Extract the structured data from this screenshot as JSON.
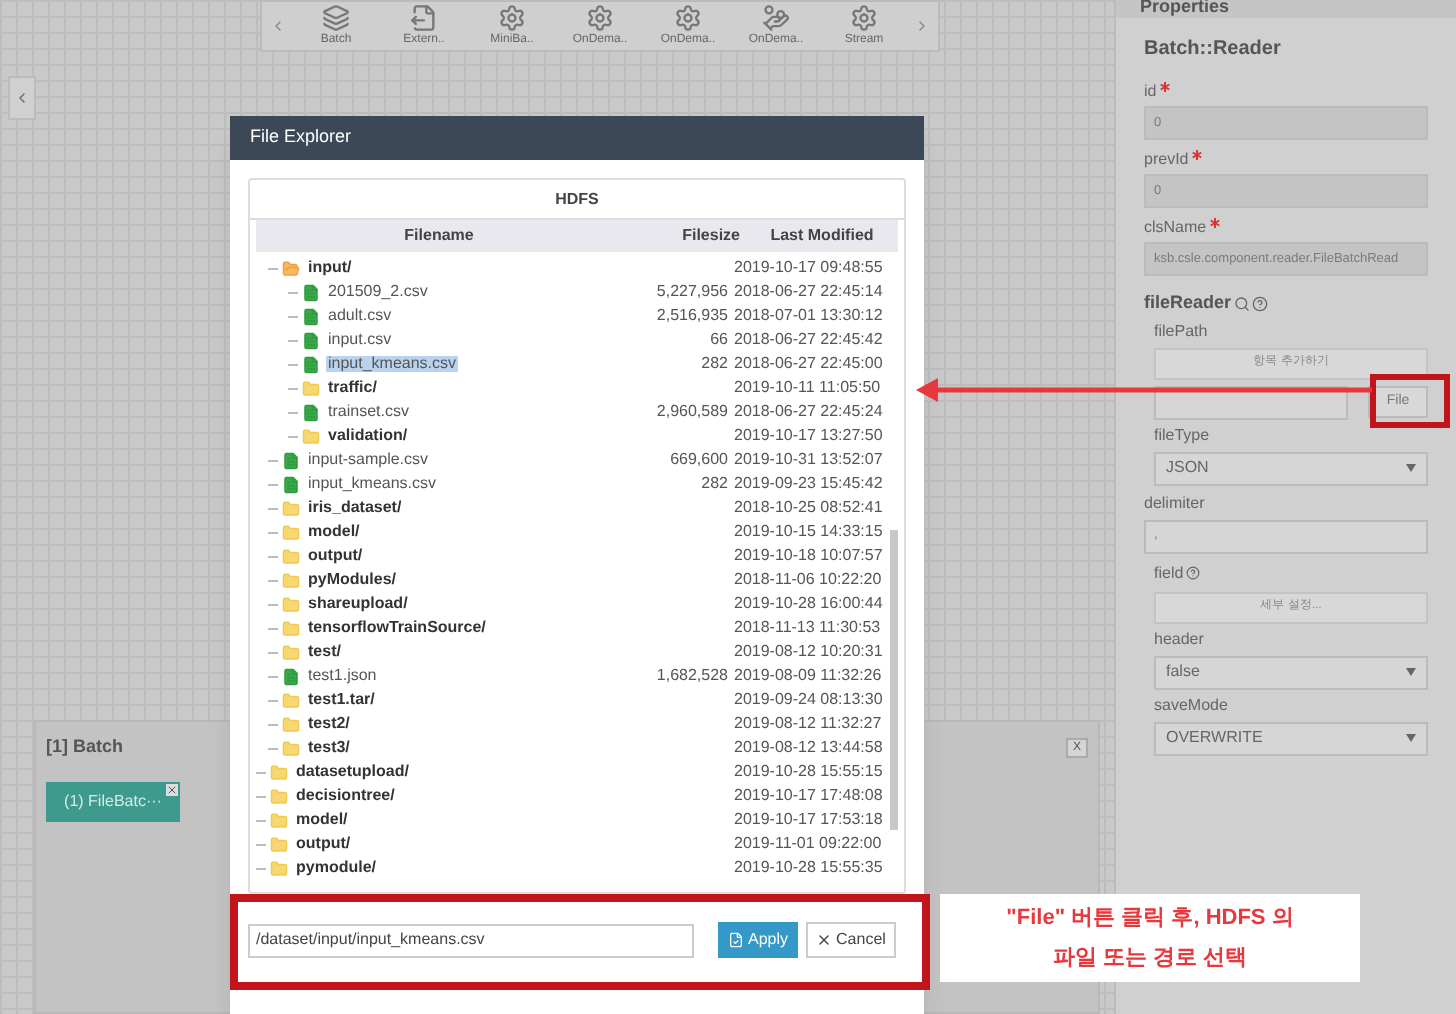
{
  "toolbar": {
    "items": [
      {
        "label": "Batch",
        "kind": "layers"
      },
      {
        "label": "Extern..",
        "kind": "export"
      },
      {
        "label": "MiniBa..",
        "kind": "gear"
      },
      {
        "label": "OnDema..",
        "kind": "gear"
      },
      {
        "label": "OnDema..",
        "kind": "gear"
      },
      {
        "label": "OnDema..",
        "kind": "hand"
      },
      {
        "label": "Stream",
        "kind": "gear"
      }
    ]
  },
  "batch_panel": {
    "title": "[1] Batch",
    "close": "X",
    "node": {
      "label": "(1) FileBatc···"
    }
  },
  "properties": {
    "header": "Properties",
    "title": "Batch::Reader",
    "fields": [
      {
        "kind": "input",
        "label": "id",
        "required": true,
        "disabled": true,
        "value": "0"
      },
      {
        "kind": "input",
        "label": "prevId",
        "required": true,
        "disabled": true,
        "value": "0"
      },
      {
        "kind": "input",
        "label": "clsName",
        "required": true,
        "disabled": true,
        "value": "ksb.csle.component.reader.FileBatchRead"
      },
      {
        "kind": "heading",
        "label": "fileReader"
      },
      {
        "kind": "file_path",
        "label": "filePath",
        "add_button": "항목 추가하기",
        "file_button": "File"
      },
      {
        "kind": "select",
        "label": "fileType",
        "value": "JSON"
      },
      {
        "kind": "input",
        "label": "delimiter",
        "required": false,
        "disabled": false,
        "value": ","
      },
      {
        "kind": "button_field",
        "label": "field",
        "button": "세부 설정..."
      },
      {
        "kind": "select",
        "label": "header",
        "value": "false"
      },
      {
        "kind": "select",
        "label": "saveMode",
        "value": "OVERWRITE"
      }
    ]
  },
  "file_explorer": {
    "title": "File Explorer",
    "source": "HDFS",
    "columns": [
      "Filename",
      "Filesize",
      "Last Modified"
    ],
    "tree": [
      {
        "children": [
          {
            "kind": "folder",
            "name": "input/",
            "modified": "2019-10-17 09:48:55",
            "expanded": true,
            "selected": false,
            "children": [
              {
                "kind": "file",
                "name": "201509_2.csv",
                "size": "5,227,956",
                "modified": "2018-06-27 22:45:14",
                "selected": false
              },
              {
                "kind": "file",
                "name": "adult.csv",
                "size": "2,516,935",
                "modified": "2018-07-01 13:30:12",
                "selected": false
              },
              {
                "kind": "file",
                "name": "input.csv",
                "size": "66",
                "modified": "2018-06-27 22:45:42",
                "selected": false
              },
              {
                "kind": "file",
                "name": "input_kmeans.csv",
                "size": "282",
                "modified": "2018-06-27 22:45:00",
                "selected": true
              },
              {
                "kind": "folder",
                "name": "traffic/",
                "modified": "2019-10-11 11:05:50",
                "expanded": false,
                "selected": false
              },
              {
                "kind": "file",
                "name": "trainset.csv",
                "size": "2,960,589",
                "modified": "2018-06-27 22:45:24",
                "selected": false
              },
              {
                "kind": "folder",
                "name": "validation/",
                "modified": "2019-10-17 13:27:50",
                "expanded": false,
                "selected": false
              }
            ]
          },
          {
            "kind": "file",
            "name": "input-sample.csv",
            "size": "669,600",
            "modified": "2019-10-31 13:52:07",
            "selected": false
          },
          {
            "kind": "file",
            "name": "input_kmeans.csv",
            "size": "282",
            "modified": "2019-09-23 15:45:42",
            "selected": false
          },
          {
            "kind": "folder",
            "name": "iris_dataset/",
            "modified": "2018-10-25 08:52:41",
            "expanded": false,
            "selected": false
          },
          {
            "kind": "folder",
            "name": "model/",
            "modified": "2019-10-15 14:33:15",
            "expanded": false,
            "selected": false
          },
          {
            "kind": "folder",
            "name": "output/",
            "modified": "2019-10-18 10:07:57",
            "expanded": false,
            "selected": false
          },
          {
            "kind": "folder",
            "name": "pyModules/",
            "modified": "2018-11-06 10:22:20",
            "expanded": false,
            "selected": false
          },
          {
            "kind": "folder",
            "name": "shareupload/",
            "modified": "2019-10-28 16:00:44",
            "expanded": false,
            "selected": false
          },
          {
            "kind": "folder",
            "name": "tensorflowTrainSource/",
            "modified": "2018-11-13 11:30:53",
            "expanded": false,
            "selected": false
          },
          {
            "kind": "folder",
            "name": "test/",
            "modified": "2019-08-12 10:20:31",
            "expanded": false,
            "selected": false
          },
          {
            "kind": "file",
            "name": "test1.json",
            "size": "1,682,528",
            "modified": "2019-08-09 11:32:26",
            "selected": false
          },
          {
            "kind": "folder",
            "name": "test1.tar/",
            "modified": "2019-09-24 08:13:30",
            "expanded": false,
            "selected": false
          },
          {
            "kind": "folder",
            "name": "test2/",
            "modified": "2019-08-12 11:32:27",
            "expanded": false,
            "selected": false
          },
          {
            "kind": "folder",
            "name": "test3/",
            "modified": "2019-08-12 13:44:58",
            "expanded": false,
            "selected": false
          }
        ]
      },
      {
        "kind": "folder",
        "name": "datasetupload/",
        "modified": "2019-10-28 15:55:15",
        "expanded": false,
        "selected": false
      },
      {
        "kind": "folder",
        "name": "decisiontree/",
        "modified": "2019-10-17 17:48:08",
        "expanded": false,
        "selected": false
      },
      {
        "kind": "folder",
        "name": "model/",
        "modified": "2019-10-17 17:53:18",
        "expanded": false,
        "selected": false
      },
      {
        "kind": "folder",
        "name": "output/",
        "modified": "2019-11-01 09:22:00",
        "expanded": false,
        "selected": false
      },
      {
        "kind": "folder",
        "name": "pymodule/",
        "modified": "2019-10-28 15:55:35",
        "expanded": false,
        "selected": false
      }
    ],
    "path": "/dataset/input/input_kmeans.csv",
    "apply": "Apply",
    "cancel": "Cancel"
  },
  "annotation": {
    "lines": [
      "\"File\" 버튼 클릭 후, HDFS 의",
      "파일 또는 경로 선택"
    ]
  }
}
